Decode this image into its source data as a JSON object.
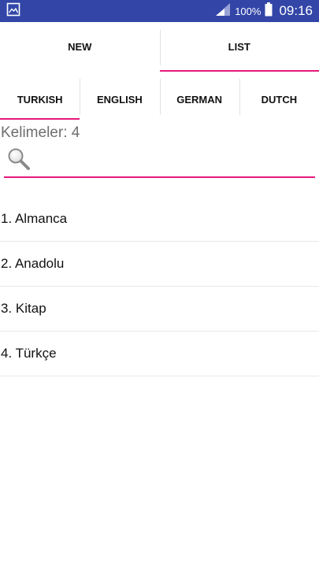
{
  "status_bar": {
    "battery_text": "100%",
    "time": "09:16",
    "icons": [
      "image-icon",
      "signal-icon",
      "battery-icon"
    ]
  },
  "main_tabs": [
    {
      "label": "NEW",
      "active": false
    },
    {
      "label": "LIST",
      "active": true
    }
  ],
  "language_tabs": [
    {
      "label": "TURKISH",
      "active": true
    },
    {
      "label": "ENGLISH",
      "active": false
    },
    {
      "label": "GERMAN",
      "active": false
    },
    {
      "label": "DUTCH",
      "active": false
    }
  ],
  "word_count": "Kelimeler: 4",
  "search": {
    "value": "",
    "placeholder": ""
  },
  "words": [
    {
      "text": "1. Almanca"
    },
    {
      "text": "2. Anadolu"
    },
    {
      "text": "3. Kitap"
    },
    {
      "text": "4. Türkçe"
    }
  ],
  "colors": {
    "status_bar": "#3346a8",
    "accent": "#e6197d"
  }
}
